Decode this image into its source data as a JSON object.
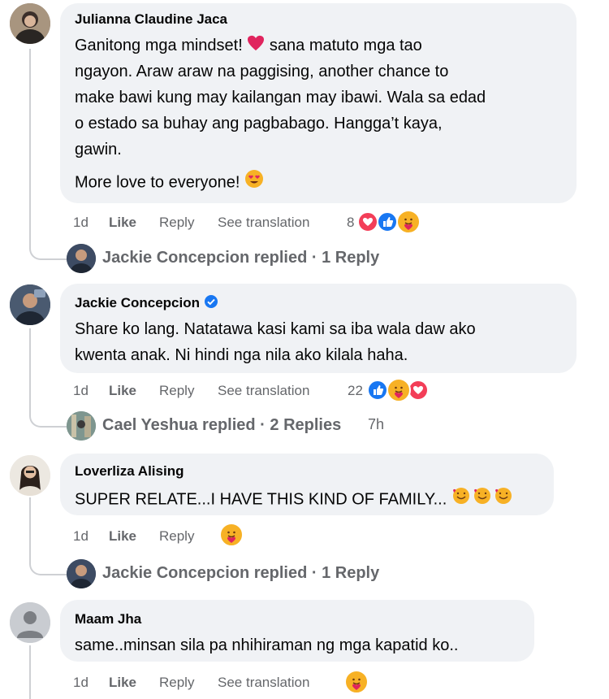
{
  "comments": [
    {
      "author": "Julianna Claudine Jaca",
      "lines": [
        "Ganitong mga mindset!",
        "sana matuto mga tao",
        "ngayon. Araw araw na paggising, another chance to",
        "make bawi kung may kailangan may ibawi. Wala sa edad",
        "o estado sa buhay ang pagbabago. Hangga’t kaya,",
        "gawin.",
        "More love to everyone!"
      ],
      "time": "1d",
      "like": "Like",
      "reply": "Reply",
      "translate": "See translation",
      "reaction_count": "8",
      "reactions": [
        "love-icon",
        "like-icon",
        "care-icon"
      ],
      "replies_summary": "Jackie Concepcion replied · 1 Reply"
    },
    {
      "author": "Jackie Concepcion",
      "verified": true,
      "lines": [
        "Share ko lang. Natatawa kasi kami sa iba wala daw ako",
        "kwenta anak. Ni hindi nga nila ako kilala haha."
      ],
      "time": "1d",
      "like": "Like",
      "reply": "Reply",
      "translate": "See translation",
      "reaction_count": "22",
      "reactions": [
        "like-icon",
        "care-icon",
        "love-icon"
      ],
      "replies_summary": "Cael Yeshua replied · 2 Replies",
      "replies_time": "7h"
    },
    {
      "author": "Loverliza Alising",
      "lines": [
        "SUPER RELATE...I HAVE THIS KIND OF FAMILY..."
      ],
      "time": "1d",
      "like": "Like",
      "reply": "Reply",
      "reactions": [
        "care-icon"
      ],
      "replies_summary": "Jackie Concepcion replied · 1 Reply"
    },
    {
      "author": "Maam Jha",
      "lines": [
        "same..minsan sila pa nhihiraman ng mga kapatid ko.."
      ],
      "time": "1d",
      "like": "Like",
      "reply": "Reply",
      "translate": "See translation",
      "reactions": [
        "care-icon"
      ]
    }
  ],
  "colors": {
    "bubble": "#f0f2f5",
    "meta": "#65676b",
    "like_blue": "#1877f2",
    "love_red": "#f33e58",
    "care_yellow": "#f7b125"
  }
}
